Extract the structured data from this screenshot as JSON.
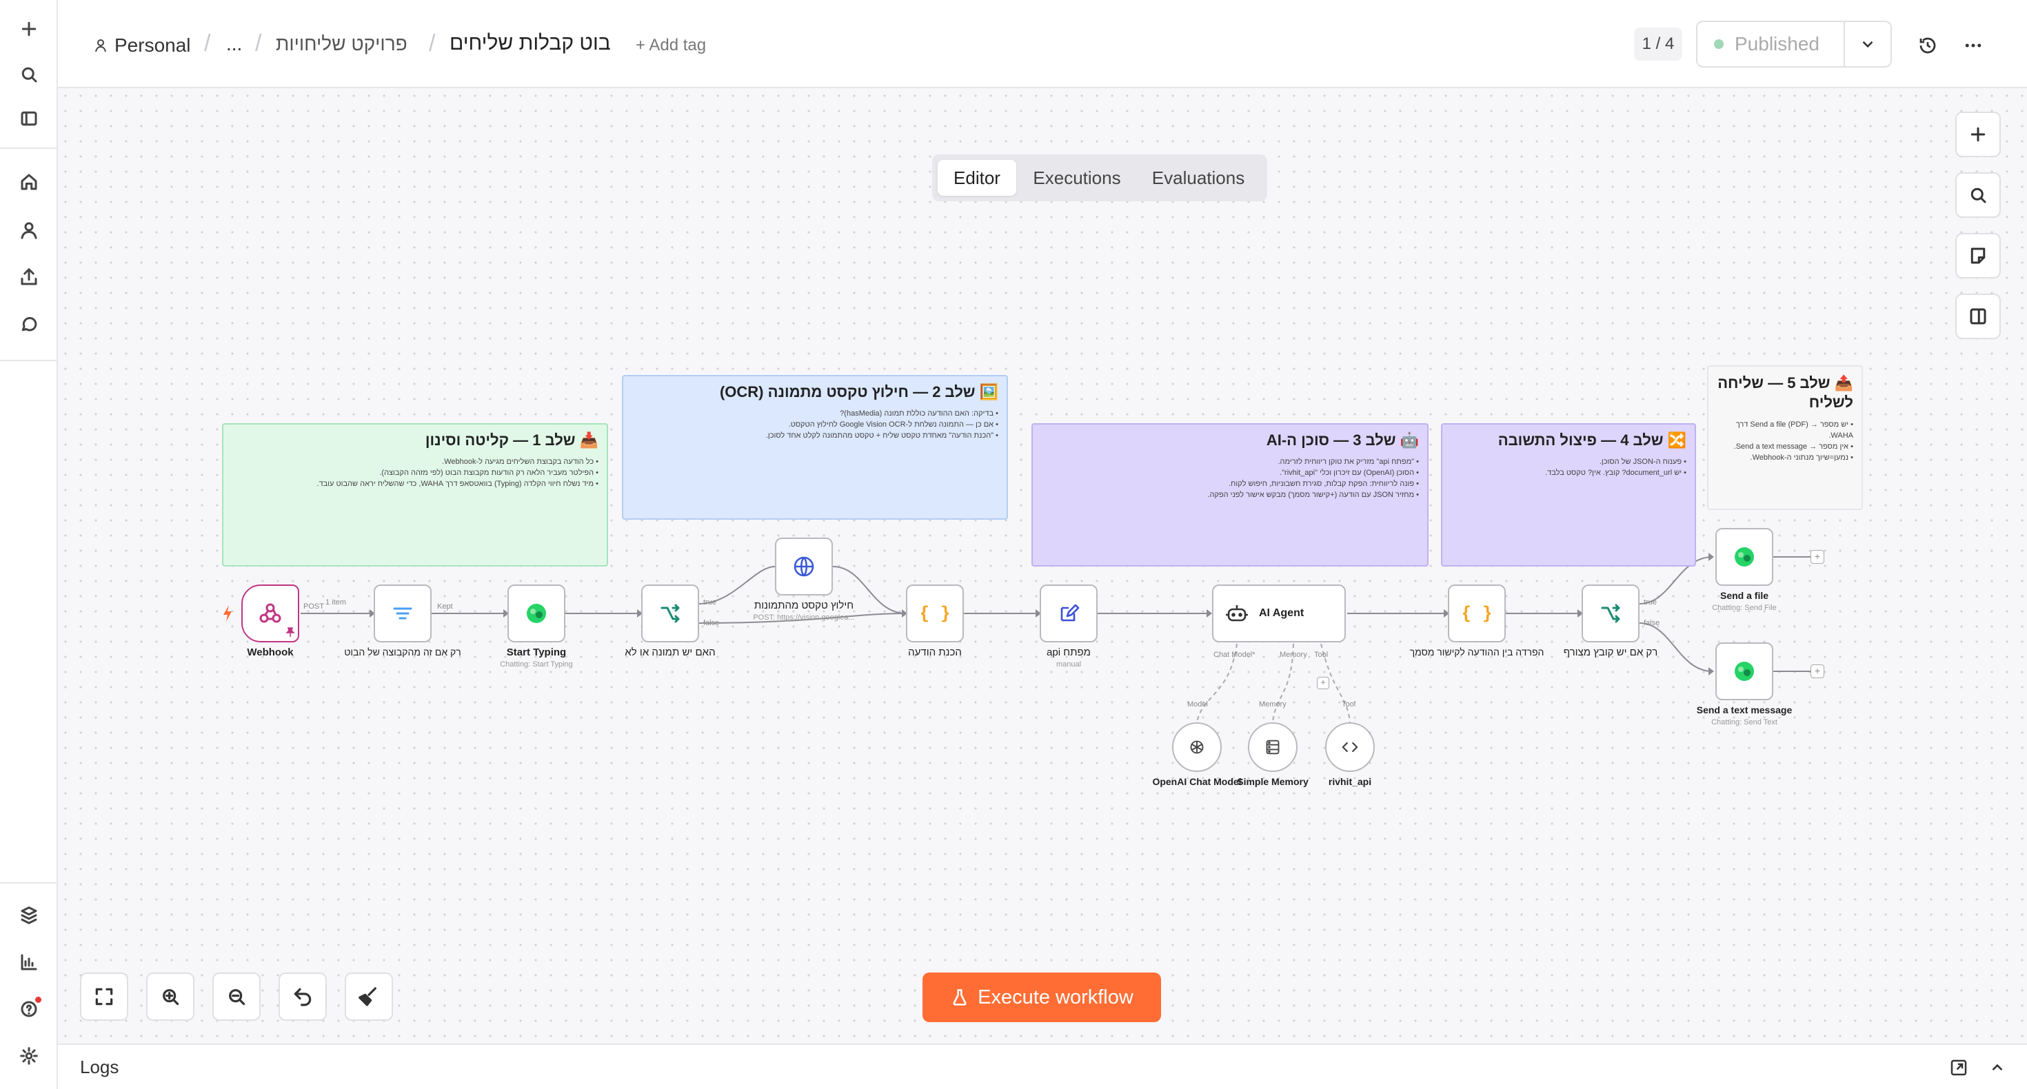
{
  "breadcrumb": {
    "owner": "Personal",
    "ellipsis": "...",
    "project": "פרויקט שליחויות",
    "workflow_name": "בוט קבלות שליחים",
    "add_tag": "+ Add tag"
  },
  "header": {
    "version_counter": "1 / 4",
    "publish_status": "Published"
  },
  "tabs": [
    "Editor",
    "Executions",
    "Evaluations"
  ],
  "sticky_notes": [
    {
      "title": "📥 שלב 1 — קליטה וסינון",
      "lines": [
        "• כל הודעה בקבוצת השליחים מגיעה ל-Webhook.",
        "• הפילטר מעביר הלאה רק הודעות מקבוצת הבוט (לפי מזהה הקבוצה).",
        "• מיד נשלח חיווי הקלדה (Typing) בוואטסאפ דרך WAHA, כדי שהשליח יראה שהבוט עובד."
      ]
    },
    {
      "title": "🖼️ שלב 2 — חילוץ טקסט מתמונה (OCR)",
      "lines": [
        "• בדיקה: האם ההודעה כוללת תמונה (hasMedia)?",
        "• אם כן — התמונה נשלחת ל-Google Vision OCR לחילוץ הטקסט.",
        "• \"הכנת הודעה\" מאחדת טקסט שליח + טקסט מהתמונה לקלט אחד לסוכן."
      ]
    },
    {
      "title": "🤖 שלב 3 — סוכן ה-AI",
      "lines": [
        "• \"מפתח api\" מזריק את טוקן ריווחית לזרימה.",
        "• הסוכן (OpenAI) עם זיכרון וכלי \"rivhit_api\".",
        "• פונה לריווחית: הפקת קבלות, סגירת חשבוניות, חיפוש לקוח.",
        "• מחזיר JSON עם הודעה (+קישור מסמך) מבקש אישור לפני הפקה."
      ]
    },
    {
      "title": "🔀 שלב 4 — פיצול התשובה",
      "lines": [
        "• פענוח ה-JSON של הסוכן.",
        "• יש document_url? קובץ. אין? טקסט בלבד."
      ]
    },
    {
      "title": "📤 שלב 5 — שליחה לשליח",
      "lines": [
        "• יש מספר → Send a file (PDF) דרך WAHA.",
        "• אין מספר → Send a text message.",
        "• נמען=שיוך מנתוני ה-Webhook."
      ]
    }
  ],
  "nodes": {
    "webhook": {
      "label": "Webhook"
    },
    "filter": {
      "label": "רק אם זה מהקבוצה של הבוט"
    },
    "start_typing": {
      "label": "Start Typing",
      "sub": "Chatting: Start Typing"
    },
    "if_image": {
      "label": "האם יש תמונה או לא"
    },
    "ocr": {
      "label": "חילוץ טקסט מהתמונות",
      "sub": "POST: https://vision.googlea..."
    },
    "prepare": {
      "label": "הכנת הודעה"
    },
    "api_key": {
      "label": "api מפתח",
      "sub": "manual"
    },
    "ai_agent": {
      "label": "AI Agent"
    },
    "split": {
      "label": "הפרדה בין ההודעה לקישור מסמך"
    },
    "if_file": {
      "label": "רק אם יש קובץ מצורף"
    },
    "send_file": {
      "label": "Send a file",
      "sub": "Chatting: Send File"
    },
    "send_text": {
      "label": "Send a text message",
      "sub": "Chatting: Send Text"
    },
    "openai": {
      "label": "OpenAI Chat Model"
    },
    "memory": {
      "label": "Simple Memory"
    },
    "rivhit": {
      "label": "rivhit_api"
    }
  },
  "port_labels": {
    "post": "POST",
    "one_item": "1 item",
    "kept": "Kept",
    "true1": "true",
    "false1": "false",
    "true2": "true",
    "false2": "false",
    "chat_model": "Chat Model*",
    "memory": "Memory",
    "tool": "Tool",
    "model_b": "Model",
    "memory_b": "Memory",
    "tool_b": "Tool"
  },
  "execute_button": "Execute workflow",
  "logs_label": "Logs",
  "colors": {
    "execute": "#ff6d35",
    "webhook_accent": "#c13584",
    "note_green": "#e1f8e8",
    "note_blue": "#dbe8fd",
    "note_purple": "#ddd5fb",
    "note_grey": "#f7f7f8"
  }
}
